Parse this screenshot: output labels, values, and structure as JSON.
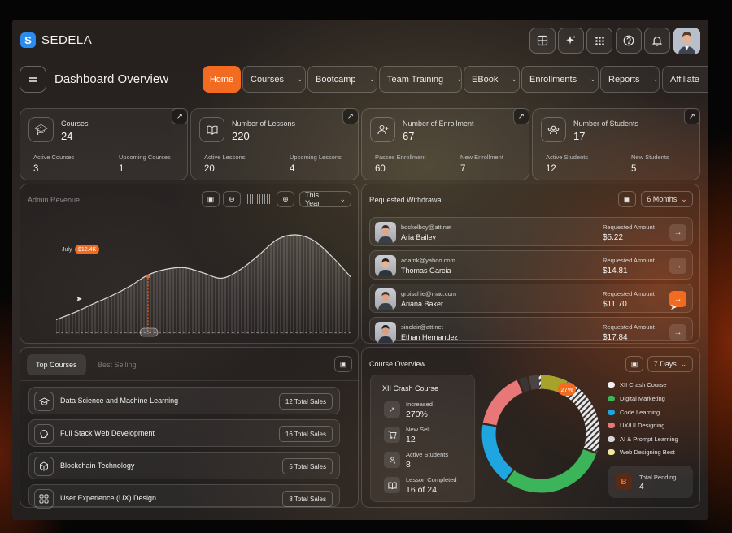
{
  "app": {
    "brand": "SEDELA",
    "logo_letter": "S",
    "page_title": "Dashboard Overview"
  },
  "top_icons": [
    "globe-grid-icon",
    "sparkle-icon",
    "apps-grid-icon",
    "help-icon",
    "bell-icon"
  ],
  "nav": [
    {
      "label": "Home",
      "active": true
    },
    {
      "label": "Courses"
    },
    {
      "label": "Bootcamp"
    },
    {
      "label": "Team Training"
    },
    {
      "label": "EBook"
    },
    {
      "label": "Enrollments"
    },
    {
      "label": "Reports"
    },
    {
      "label": "Affiliate"
    }
  ],
  "stats": [
    {
      "title": "Courses",
      "value": "24",
      "sub": [
        {
          "label": "Active Courses",
          "value": "3"
        },
        {
          "label": "Upcoming Courses",
          "value": "1"
        }
      ]
    },
    {
      "title": "Number of Lessons",
      "value": "220",
      "sub": [
        {
          "label": "Active Lessons",
          "value": "20"
        },
        {
          "label": "Upcoming Lessons",
          "value": "4"
        }
      ]
    },
    {
      "title": "Number of Enrollment",
      "value": "67",
      "sub": [
        {
          "label": "Passes Enrollment",
          "value": "60"
        },
        {
          "label": "New Enrollment",
          "value": "7"
        }
      ]
    },
    {
      "title": "Number of Students",
      "value": "17",
      "sub": [
        {
          "label": "Active Students",
          "value": "12"
        },
        {
          "label": "New Students",
          "value": "5"
        }
      ]
    }
  ],
  "revenue": {
    "title": "Admin Revenue",
    "period": "This Year",
    "marker_label": "July",
    "marker_value": "$12.4K"
  },
  "chart_data": {
    "type": "area",
    "title": "Admin Revenue",
    "x": [
      0,
      1,
      2,
      3,
      4,
      5,
      6,
      7,
      8,
      9,
      10,
      11,
      12,
      13,
      14,
      15,
      16
    ],
    "values": [
      3.0,
      4.5,
      6.3,
      8.0,
      10.0,
      12.4,
      13.6,
      13.9,
      12.8,
      11.7,
      13.5,
      16.5,
      19.8,
      20.8,
      19.6,
      16.2,
      12.0
    ],
    "annotation": {
      "label": "July",
      "value": "$12.4K",
      "index": 5
    }
  },
  "withdrawal": {
    "title": "Requested Withdrawal",
    "period": "6 Months",
    "amount_label": "Requested Amount",
    "rows": [
      {
        "email": "bockelboy@att.net",
        "name": "Aria Bailey",
        "amount": "$5.22",
        "highlight": false
      },
      {
        "email": "adamk@yahoo.com",
        "name": "Thomas Garcia",
        "amount": "$14.81",
        "highlight": false
      },
      {
        "email": "groischie@mac.com",
        "name": "Ariana Baker",
        "amount": "$11.70",
        "highlight": true
      },
      {
        "email": "sinclair@att.net",
        "name": "Ethan Hernandez",
        "amount": "$17.84",
        "highlight": false
      }
    ]
  },
  "top_courses": {
    "tabs": [
      "Top Courses",
      "Best Selling"
    ],
    "rows": [
      {
        "name": "Data Science and Machine Learning",
        "sales": "12 Total Sales",
        "icon": "graduation-cap-icon"
      },
      {
        "name": "Full Stack Web Development",
        "sales": "16 Total Sales",
        "icon": "brain-icon"
      },
      {
        "name": "Blockchain Technology",
        "sales": "5 Total Sales",
        "icon": "cube-icon"
      },
      {
        "name": "User Experience (UX) Design",
        "sales": "8 Total Sales",
        "icon": "grid-icon"
      }
    ]
  },
  "overview": {
    "title": "Course Overview",
    "period": "7 Days",
    "course": "XII Crash Course",
    "metrics": [
      {
        "label": "Increased",
        "value": "270%"
      },
      {
        "label": "New Sell",
        "value": "12"
      },
      {
        "label": "Active Students",
        "value": "8"
      },
      {
        "label": "Lesson Completed",
        "value": "16 of 24"
      }
    ],
    "donut_label": "27%",
    "pending_label": "Total Pending",
    "pending_value": "4",
    "pending_letter": "B",
    "legend": [
      {
        "label": "XII Crash Course",
        "color": "#f1f1f1"
      },
      {
        "label": "Digital Marketing",
        "color": "#3cb55a"
      },
      {
        "label": "Code Learning",
        "color": "#1fa6e0"
      },
      {
        "label": "UX/UI Designing",
        "color": "#e87878"
      },
      {
        "label": "AI & Prompt Learning",
        "color": "#d6d6d6"
      },
      {
        "label": "Web Designing Best",
        "color": "#f1e79a"
      }
    ]
  }
}
